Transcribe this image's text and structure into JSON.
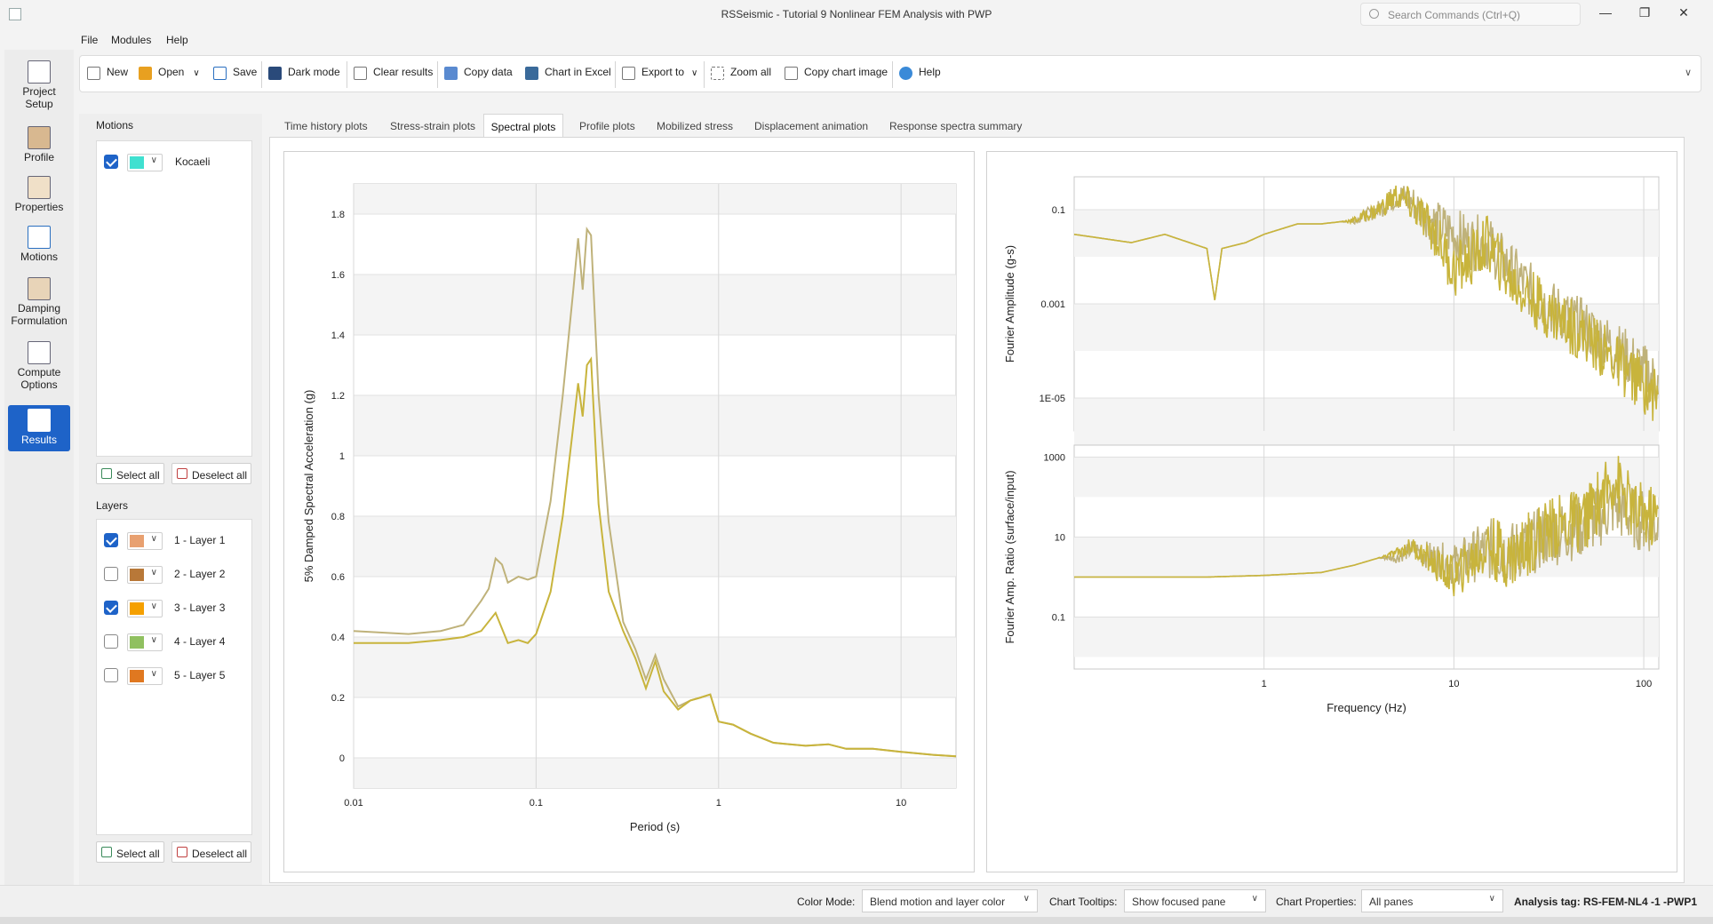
{
  "window": {
    "title": "RSSeismic - Tutorial 9 Nonlinear FEM Analysis with PWP",
    "search_placeholder": "Search Commands (Ctrl+Q)"
  },
  "menu": [
    "File",
    "Modules",
    "Help"
  ],
  "toolbar": {
    "new": "New",
    "open": "Open",
    "save": "Save",
    "dark_mode": "Dark mode",
    "clear_results": "Clear results",
    "copy_data": "Copy data",
    "chart_in_excel": "Chart in Excel",
    "export_to": "Export to",
    "zoom_all": "Zoom all",
    "copy_chart_image": "Copy chart image",
    "help": "Help"
  },
  "nav": {
    "project_setup": [
      "Project",
      "Setup"
    ],
    "profile": "Profile",
    "properties": "Properties",
    "motions": "Motions",
    "damping": [
      "Damping",
      "Formulation"
    ],
    "compute": [
      "Compute",
      "Options"
    ],
    "results": "Results"
  },
  "motions": {
    "heading": "Motions",
    "items": [
      {
        "label": "Kocaeli",
        "checked": true,
        "color": "#40e0d0"
      }
    ],
    "select_all": "Select all",
    "deselect_all": "Deselect all"
  },
  "layers": {
    "heading": "Layers",
    "items": [
      {
        "label": "1 - Layer 1",
        "checked": true,
        "color": "#e8a070"
      },
      {
        "label": "2 - Layer 2",
        "checked": false,
        "color": "#b87838"
      },
      {
        "label": "3 - Layer 3",
        "checked": true,
        "color": "#f5a000"
      },
      {
        "label": "4 - Layer 4",
        "checked": false,
        "color": "#90c060"
      },
      {
        "label": "5 - Layer 5",
        "checked": false,
        "color": "#e07820"
      }
    ],
    "select_all": "Select all",
    "deselect_all": "Deselect all"
  },
  "tabs": [
    "Time history plots",
    "Stress-strain plots",
    "Spectral plots",
    "Profile plots",
    "Mobilized stress",
    "Displacement animation",
    "Response spectra summary"
  ],
  "selected_tab": "Spectral plots",
  "colors": {
    "series_light": "#bfb27a",
    "series_dark": "#c8b43c",
    "accent": "#1e63c8"
  },
  "chart_data": [
    {
      "type": "line",
      "xlabel": "Period (s)",
      "ylabel": "5% Damped Spectral Acceleration (g)",
      "xscale": "log",
      "xlim": [
        0.01,
        20
      ],
      "ylim": [
        -0.1,
        1.9
      ],
      "xticks": [
        "0.01",
        "0.1",
        "1",
        "10"
      ],
      "yticks": [
        "0",
        "0.2",
        "0.4",
        "0.6",
        "0.8",
        "1",
        "1.2",
        "1.4",
        "1.6",
        "1.8"
      ],
      "series": [
        {
          "color": "#bfb27a",
          "x": [
            0.01,
            0.02,
            0.03,
            0.04,
            0.05,
            0.055,
            0.06,
            0.065,
            0.07,
            0.08,
            0.09,
            0.1,
            0.12,
            0.14,
            0.16,
            0.17,
            0.18,
            0.19,
            0.2,
            0.22,
            0.25,
            0.3,
            0.35,
            0.4,
            0.45,
            0.5,
            0.6,
            0.7,
            0.8,
            0.9,
            1.0,
            1.2,
            1.5,
            2.0,
            3.0,
            4.0,
            5.0,
            7.0,
            10.0,
            15.0,
            20.0
          ],
          "y": [
            0.42,
            0.41,
            0.42,
            0.44,
            0.52,
            0.56,
            0.66,
            0.64,
            0.58,
            0.6,
            0.59,
            0.6,
            0.85,
            1.2,
            1.55,
            1.72,
            1.55,
            1.75,
            1.73,
            1.2,
            0.78,
            0.45,
            0.36,
            0.26,
            0.34,
            0.26,
            0.17,
            0.19,
            0.2,
            0.21,
            0.12,
            0.11,
            0.08,
            0.05,
            0.04,
            0.045,
            0.03,
            0.03,
            0.02,
            0.01,
            0.005
          ]
        },
        {
          "color": "#c8b43c",
          "x": [
            0.01,
            0.02,
            0.03,
            0.04,
            0.05,
            0.06,
            0.07,
            0.08,
            0.09,
            0.1,
            0.12,
            0.14,
            0.16,
            0.17,
            0.18,
            0.19,
            0.2,
            0.22,
            0.25,
            0.3,
            0.35,
            0.4,
            0.45,
            0.5,
            0.6,
            0.7,
            0.8,
            0.9,
            1.0,
            1.2,
            1.5,
            2.0,
            3.0,
            4.0,
            5.0,
            7.0,
            10.0,
            15.0,
            20.0
          ],
          "y": [
            0.38,
            0.38,
            0.39,
            0.4,
            0.42,
            0.48,
            0.38,
            0.39,
            0.38,
            0.41,
            0.55,
            0.8,
            1.1,
            1.24,
            1.13,
            1.3,
            1.32,
            0.84,
            0.55,
            0.42,
            0.33,
            0.23,
            0.32,
            0.22,
            0.16,
            0.19,
            0.2,
            0.21,
            0.12,
            0.11,
            0.08,
            0.05,
            0.04,
            0.045,
            0.03,
            0.03,
            0.02,
            0.01,
            0.005
          ]
        }
      ]
    },
    {
      "type": "line",
      "ylabel": "Fourier Amplitude (g-s)",
      "xscale": "log",
      "yscale": "log",
      "xlim": [
        0.1,
        120
      ],
      "ylim": [
        2e-06,
        0.5
      ],
      "yticks": [
        "0.1",
        "0.001",
        "1E-05"
      ],
      "series": [
        {
          "color": "#bfb27a",
          "x": [
            0.1,
            0.2,
            0.3,
            0.5,
            0.55,
            0.6,
            0.8,
            1.0,
            1.5,
            2,
            3,
            4,
            5,
            6,
            7,
            8,
            10,
            12,
            15,
            20,
            30,
            50,
            80,
            120
          ],
          "y": [
            0.03,
            0.02,
            0.03,
            0.015,
            0.0012,
            0.015,
            0.02,
            0.03,
            0.05,
            0.05,
            0.06,
            0.1,
            0.2,
            0.15,
            0.08,
            0.05,
            0.03,
            0.02,
            0.02,
            0.005,
            0.001,
            0.0003,
            8e-05,
            2e-05
          ]
        },
        {
          "color": "#c8b43c",
          "x": [
            0.1,
            0.2,
            0.3,
            0.5,
            0.55,
            0.6,
            0.8,
            1.0,
            1.5,
            2,
            3,
            4,
            5,
            6,
            7,
            8,
            10,
            12,
            15,
            20,
            30,
            50,
            80,
            120
          ],
          "y": [
            0.03,
            0.02,
            0.03,
            0.015,
            0.0012,
            0.015,
            0.02,
            0.03,
            0.05,
            0.05,
            0.06,
            0.1,
            0.2,
            0.12,
            0.06,
            0.03,
            0.005,
            0.008,
            0.02,
            0.003,
            0.0008,
            0.0002,
            4e-05,
            1e-05
          ]
        }
      ]
    },
    {
      "type": "line",
      "xlabel": "Frequency (Hz)",
      "ylabel": "Fourier Amp. Ratio (surface/input)",
      "xscale": "log",
      "yscale": "log",
      "xlim": [
        0.1,
        120
      ],
      "ylim": [
        0.005,
        2000
      ],
      "xticks": [
        "1",
        "10",
        "100"
      ],
      "yticks": [
        "1000",
        "10",
        "0.1"
      ],
      "series": [
        {
          "color": "#bfb27a",
          "x": [
            0.1,
            0.5,
            1,
            2,
            3,
            4,
            5,
            6,
            8,
            10,
            15,
            20,
            30,
            50,
            70,
            90,
            120
          ],
          "y": [
            1.0,
            1.0,
            1.1,
            1.3,
            2,
            3,
            3,
            5,
            3,
            2,
            5,
            4,
            10,
            20,
            60,
            30,
            20
          ]
        },
        {
          "color": "#c8b43c",
          "x": [
            0.1,
            0.5,
            1,
            2,
            3,
            4,
            5,
            6,
            8,
            10,
            15,
            20,
            30,
            50,
            70,
            90,
            120
          ],
          "y": [
            1.0,
            1.0,
            1.1,
            1.3,
            2,
            3,
            4,
            6,
            2,
            1,
            6,
            3,
            15,
            30,
            300,
            40,
            30
          ]
        }
      ]
    }
  ],
  "status": {
    "color_mode_label": "Color Mode:",
    "color_mode_value": "Blend motion and layer color",
    "chart_tooltips_label": "Chart Tooltips:",
    "chart_tooltips_value": "Show focused pane",
    "chart_properties_label": "Chart Properties:",
    "chart_properties_value": "All panes",
    "analysis_tag": "Analysis tag: RS-FEM-NL4 -1 -PWP1"
  }
}
